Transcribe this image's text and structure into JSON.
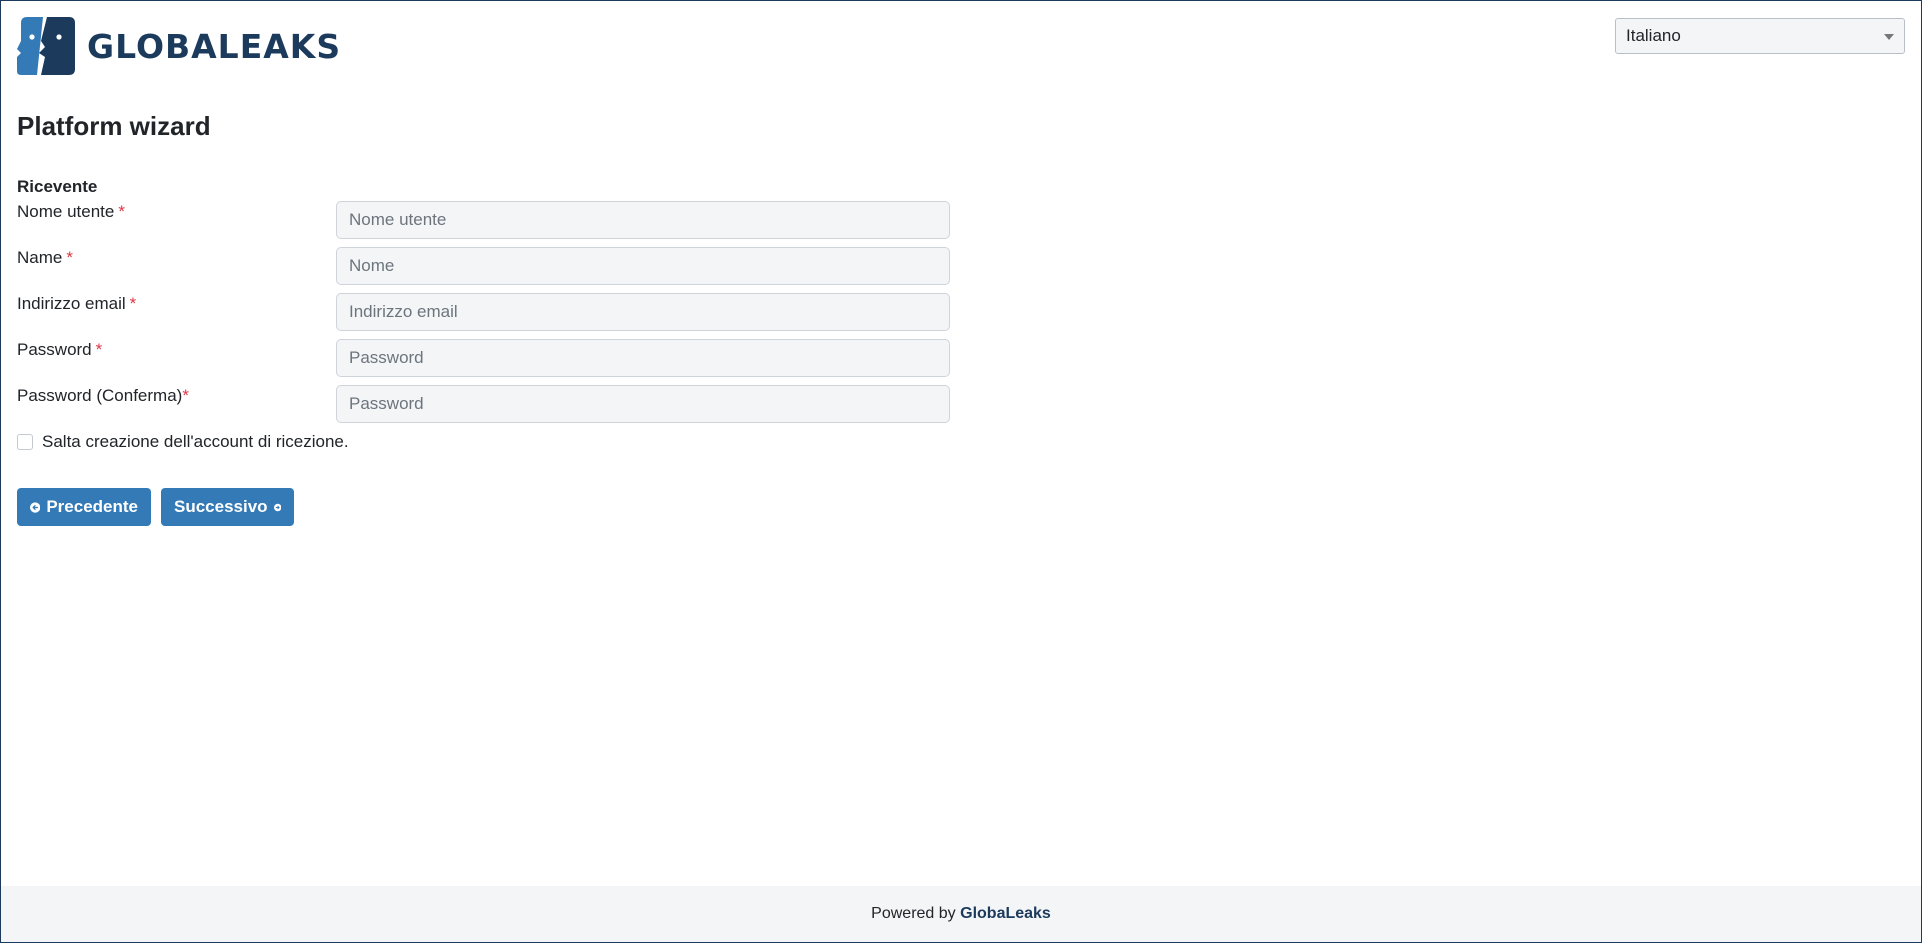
{
  "header": {
    "logo_text": "GLOBALEAKS",
    "language_select": {
      "selected": "Italiano"
    }
  },
  "page": {
    "title": "Platform wizard"
  },
  "form": {
    "section_label": "Ricevente",
    "fields": [
      {
        "label": "Nome utente",
        "required_marker": "*",
        "placeholder": "Nome utente"
      },
      {
        "label": "Name",
        "required_marker": "*",
        "placeholder": "Nome"
      },
      {
        "label": "Indirizzo email",
        "required_marker": "*",
        "placeholder": "Indirizzo email"
      },
      {
        "label": "Password",
        "required_marker": "*",
        "placeholder": "Password"
      },
      {
        "label": "Password (Conferma)",
        "required_marker": "*",
        "placeholder": "Password"
      }
    ],
    "skip_checkbox": {
      "label": "Salta creazione dell'account di ricezione.",
      "checked": false
    }
  },
  "buttons": {
    "previous": {
      "label": "Precedente",
      "icon": "arrow-circle-left-icon"
    },
    "next": {
      "label": "Successivo",
      "icon": "arrow-circle-right-icon"
    }
  },
  "footer": {
    "prefix": "Powered by",
    "brand": "GlobaLeaks"
  },
  "colors": {
    "brand_dark": "#1b3a5c",
    "brand_light": "#337ab7",
    "primary_button": "#337ab7",
    "required": "#dc3545",
    "footer_bg": "#f4f5f7"
  }
}
